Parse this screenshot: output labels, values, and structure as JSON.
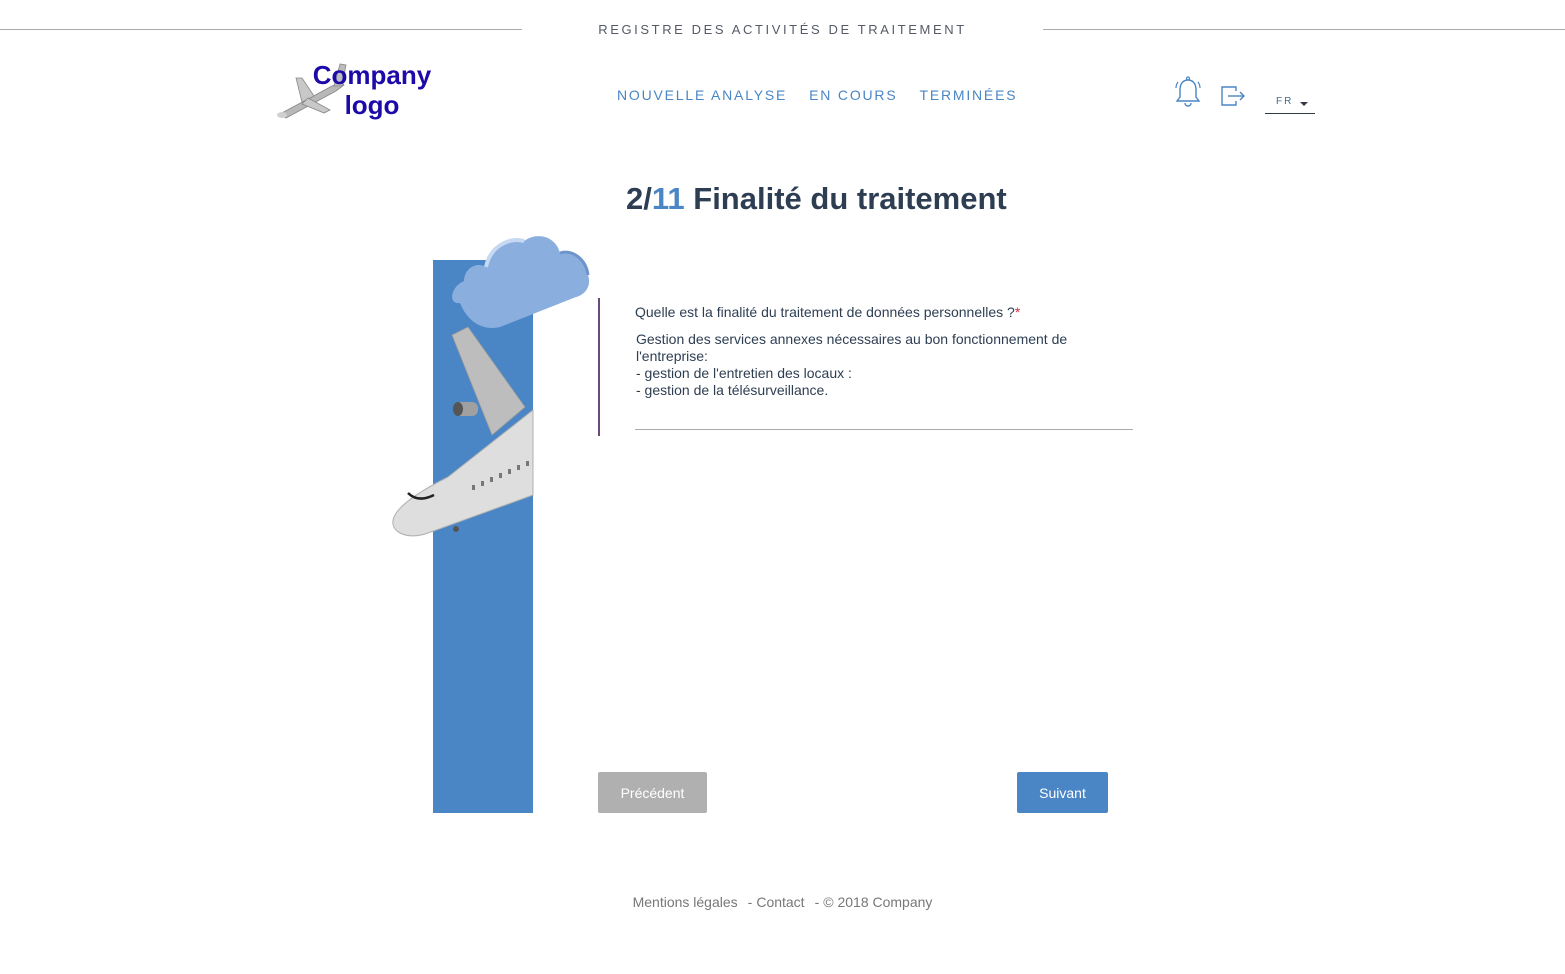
{
  "app": {
    "title": "REGISTRE DES ACTIVITÉS DE TRAITEMENT",
    "logo_line1": "Company",
    "logo_line2": "logo"
  },
  "nav": [
    {
      "label": "NOUVELLE ANALYSE"
    },
    {
      "label": "EN COURS"
    },
    {
      "label": "TERMINÉES"
    }
  ],
  "header_icons": {
    "notifications": "bell-icon",
    "logout": "logout-icon"
  },
  "language": {
    "selected": "FR"
  },
  "step": {
    "current": "2/",
    "total": "11",
    "title": " Finalité du traitement"
  },
  "question": {
    "label": "Quelle est la finalité du traitement de données personnelles ?",
    "required_mark": "*",
    "answer": "Gestion des services annexes nécessaires au bon fonctionnement de l'entreprise:\n- gestion de l'entretien des locaux :\n- gestion de la télésurveillance."
  },
  "buttons": {
    "previous": "Précédent",
    "next": "Suivant"
  },
  "footer": {
    "legal": "Mentions légales",
    "contact": "Contact",
    "copyright": "© 2018 Company",
    "separator": "-"
  },
  "colors": {
    "accent": "#4a86c5",
    "logo": "#1d0aa8",
    "title": "#2e3e52",
    "button_disabled": "#b0b0b0",
    "question_rule": "#6a4a7a"
  }
}
